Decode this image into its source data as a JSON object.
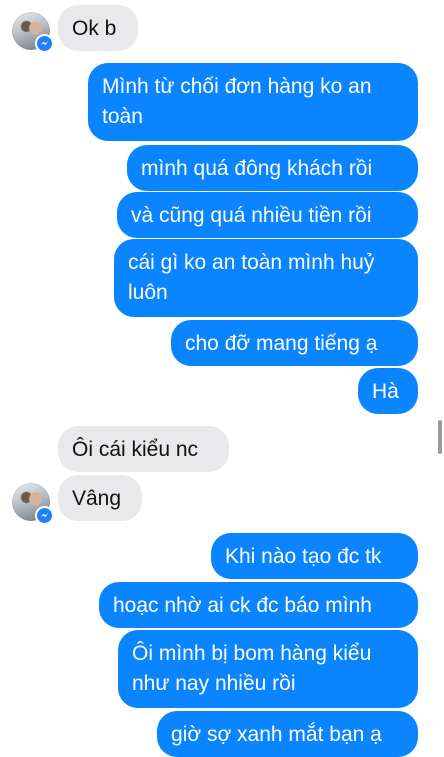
{
  "colors": {
    "incoming_bubble": "#e9e9eb",
    "outgoing_bubble": "#0a84ff",
    "badge": "#1e80ff"
  },
  "messages": [
    {
      "sender": "other",
      "text": "Ok b",
      "avatar_icon": "profile-photo-with-messenger-badge"
    },
    {
      "sender": "me",
      "text": "Mình từ chối đơn hàng ko an\ntoàn"
    },
    {
      "sender": "me",
      "text": "mình quá đông khách rồi"
    },
    {
      "sender": "me",
      "text": "và cũng quá nhiều tiền rồi"
    },
    {
      "sender": "me",
      "text": "cái gì ko an toàn mình huỷ\nluôn"
    },
    {
      "sender": "me",
      "text": "cho đỡ mang tiếng ạ"
    },
    {
      "sender": "me",
      "text": "Hà"
    },
    {
      "sender": "other",
      "text": "Ôi cái kiểu nc"
    },
    {
      "sender": "other",
      "text": "Vâng",
      "avatar_icon": "profile-photo-with-messenger-badge"
    },
    {
      "sender": "me",
      "text": "Khi nào tạo đc tk"
    },
    {
      "sender": "me",
      "text": "hoạc nhờ ai ck đc báo mình"
    },
    {
      "sender": "me",
      "text": "Ôi mình bị bom hàng kiểu\nnhư nay nhiều rồi"
    },
    {
      "sender": "me",
      "text": "giờ sợ xanh mắt bạn ạ"
    }
  ]
}
